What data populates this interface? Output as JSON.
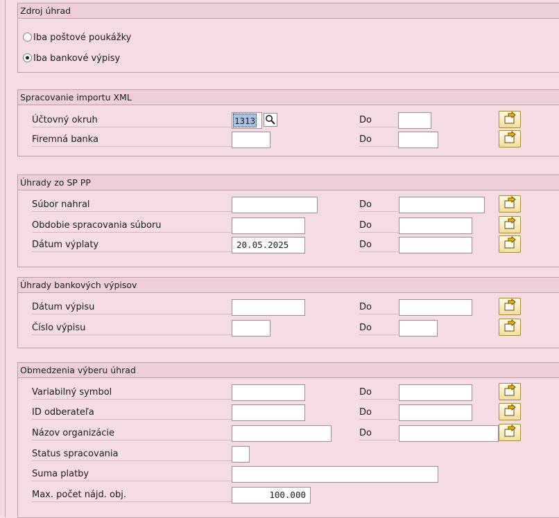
{
  "zdroj": {
    "title": "Zdroj úhrad",
    "options": [
      {
        "label": "Iba poštové poukážky",
        "selected": false
      },
      {
        "label": "Iba bankové výpisy",
        "selected": true
      }
    ]
  },
  "xml": {
    "title": "Spracovanie importu XML",
    "rows": [
      {
        "label": "Účtovný okruh",
        "value": "1313",
        "do_label": "Do",
        "to_value": ""
      },
      {
        "label": "Firemná banka",
        "value": "",
        "do_label": "Do",
        "to_value": ""
      }
    ]
  },
  "sppp": {
    "title": "Úhrady zo SP PP",
    "rows": [
      {
        "label": "Súbor nahral",
        "value": "",
        "do_label": "Do",
        "to_value": ""
      },
      {
        "label": "Obdobie spracovania súboru",
        "value": "",
        "do_label": "Do",
        "to_value": ""
      },
      {
        "label": "Dátum výplaty",
        "value": "20.05.2025",
        "do_label": "Do",
        "to_value": ""
      }
    ]
  },
  "bank": {
    "title": "Úhrady bankových výpisov",
    "rows": [
      {
        "label": "Dátum výpisu",
        "value": "",
        "do_label": "Do",
        "to_value": ""
      },
      {
        "label": "Číslo výpisu",
        "value": "",
        "do_label": "Do",
        "to_value": ""
      }
    ]
  },
  "obm": {
    "title": "Obmedzenia výberu úhrad",
    "rows": [
      {
        "label": "Variabilný symbol",
        "value": "",
        "do_label": "Do",
        "to_value": ""
      },
      {
        "label": "ID odberateľa",
        "value": "",
        "do_label": "Do",
        "to_value": ""
      },
      {
        "label": "Názov organizácie",
        "value": "",
        "do_label": "Do",
        "to_value": ""
      },
      {
        "label": "Status spracovania",
        "value": ""
      },
      {
        "label": "Suma platby",
        "value": ""
      },
      {
        "label": "Max. počet nájd. obj.",
        "value": "100.000"
      }
    ]
  },
  "icons": {
    "value_help": "magnifier-icon",
    "multiple_selection": "multiple-selection-arrow-icon"
  },
  "colors": {
    "background": "#f4dce2",
    "header": "#eecfd8",
    "selection": "#a7c0e4",
    "button": "#f3dda0"
  }
}
